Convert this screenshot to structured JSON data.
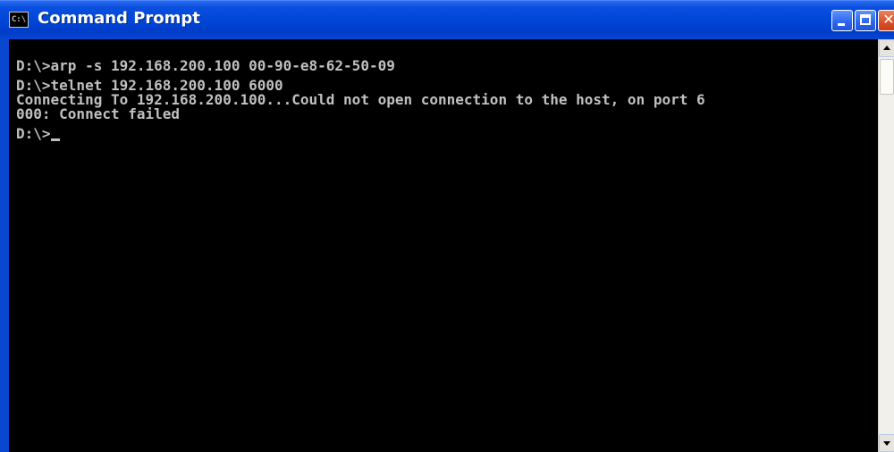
{
  "window": {
    "title": "Command Prompt",
    "icon_text": "C:\\",
    "buttons": {
      "minimize": "minimize",
      "maximize": "maximize",
      "close": "close"
    }
  },
  "console": {
    "lines": [
      "D:\\>arp -s 192.168.200.100 00-90-e8-62-50-09",
      "",
      "D:\\>telnet 192.168.200.100 6000",
      "Connecting To 192.168.200.100...Could not open connection to the host, on port 6",
      "000: Connect failed",
      "",
      "D:\\>"
    ]
  },
  "colors": {
    "titlebar": "#0046d8",
    "console_bg": "#000000",
    "console_text": "#c0c0c0"
  }
}
